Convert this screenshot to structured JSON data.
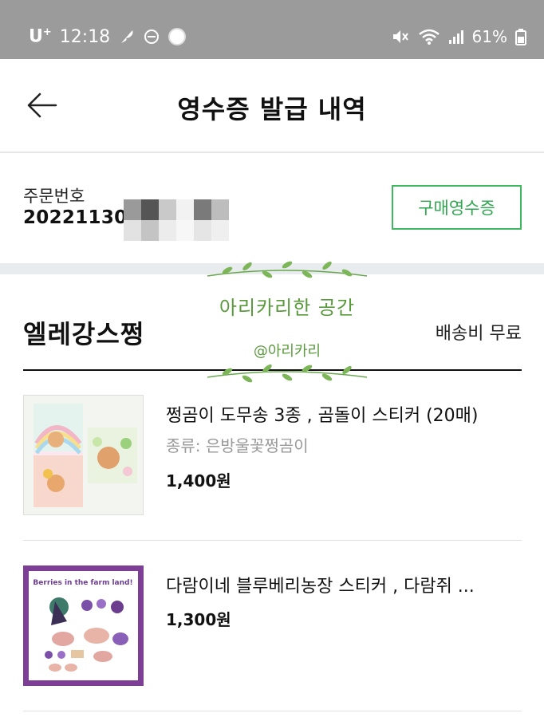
{
  "status_bar": {
    "carrier": "U",
    "carrier_sup": "+",
    "time": "12:18",
    "battery": "61%"
  },
  "header": {
    "title": "영수증 발급 내역",
    "back_icon": "arrow-left-icon"
  },
  "order": {
    "label": "주문번호",
    "number_visible": "20221130",
    "receipt_button": "구매영수증"
  },
  "shop": {
    "name": "엘레강스쩡",
    "shipping": "배송비 무료"
  },
  "watermark": {
    "title": "아리카리한 공간",
    "subtitle": "@아리카리"
  },
  "items": [
    {
      "title": "쩡곰이 도무송 3종 , 곰돌이 스티커 (20매)",
      "option": "종류: 은방울꽃쩡곰이",
      "price": "1,400원"
    },
    {
      "title": "다람이네 블루베리농장 스티커 , 다람쥐 ...",
      "price": "1,300원",
      "thumb_text": "Berries in the farm land!"
    }
  ],
  "colors": {
    "accent_green": "#3fb660",
    "status_bar": "#9b9b9b",
    "watermark_green": "#5a9a3c"
  }
}
